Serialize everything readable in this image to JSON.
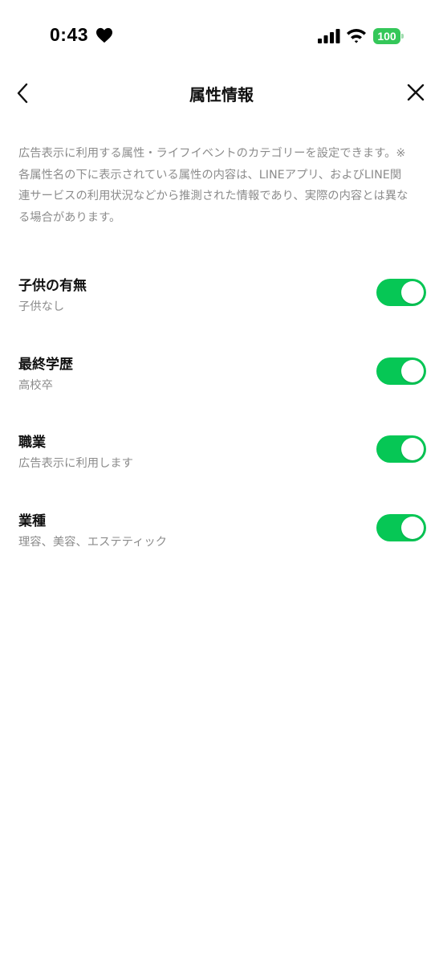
{
  "status_bar": {
    "time": "0:43",
    "battery": "100",
    "icons": [
      "heart-icon",
      "signal-icon",
      "wifi-icon",
      "battery-icon"
    ]
  },
  "header": {
    "title": "属性情報",
    "back_icon": "chevron-left-icon",
    "close_icon": "close-icon"
  },
  "description": "広告表示に利用する属性・ライフイベントのカテゴリーを設定できます。※各属性名の下に表示されている属性の内容は、LINEアプリ、およびLINE関連サービスの利用状況などから推測された情報であり、実際の内容とは異なる場合があります。",
  "settings": [
    {
      "title": "子供の有無",
      "value": "子供なし",
      "enabled": true
    },
    {
      "title": "最終学歴",
      "value": "高校卒",
      "enabled": true
    },
    {
      "title": "職業",
      "value": "広告表示に利用します",
      "enabled": true
    },
    {
      "title": "業種",
      "value": "理容、美容、エステティック",
      "enabled": true
    }
  ],
  "colors": {
    "toggle_on": "#06c755",
    "battery": "#34c759",
    "secondary_text": "#8c8c8c"
  }
}
